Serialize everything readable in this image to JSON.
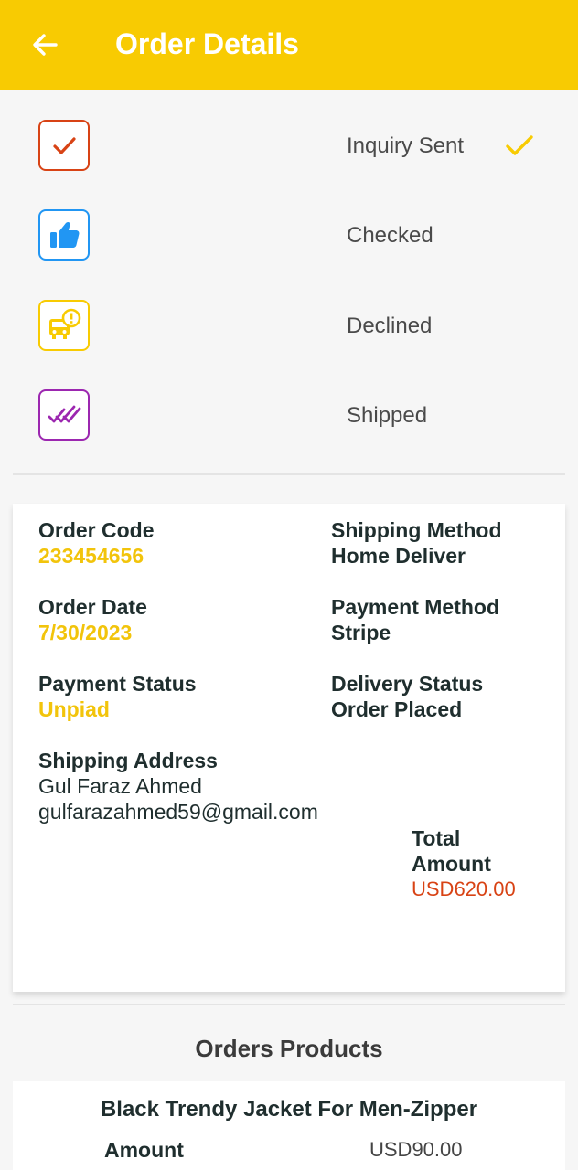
{
  "header": {
    "title": "Order Details",
    "background": "#f8cb02",
    "back_icon": "arrow-left-icon"
  },
  "status_steps": [
    {
      "label": "Inquiry Sent",
      "icon": "check-icon",
      "color": "#d84315",
      "completed": true
    },
    {
      "label": "Checked",
      "icon": "thumbs-up-icon",
      "color": "#2196f3",
      "completed": false
    },
    {
      "label": "Declined",
      "icon": "truck-alert-icon",
      "color": "#f8cb02",
      "completed": false
    },
    {
      "label": "Shipped",
      "icon": "double-check-icon",
      "color": "#9c27b0",
      "completed": false
    }
  ],
  "order": {
    "code_label": "Order Code",
    "code": "233454656",
    "shipping_method_label": "Shipping Method",
    "shipping_method": "Home Deliver",
    "date_label": "Order Date",
    "date": "7/30/2023",
    "payment_method_label": "Payment Method",
    "payment_method": "Stripe",
    "payment_status_label": "Payment Status",
    "payment_status": "Unpiad",
    "delivery_status_label": "Delivery Status",
    "delivery_status": "Order Placed",
    "address_label": "Shipping Address",
    "address_name": "Gul Faraz Ahmed",
    "address_email": "gulfarazahmed59@gmail.com",
    "total_label_line1": "Total",
    "total_label_line2": "Amount",
    "total": "USD620.00"
  },
  "products": {
    "section_title": "Orders Products",
    "items": [
      {
        "name": "Black Trendy Jacket For Men-Zipper",
        "amount_label": "Amount",
        "amount": "USD90.00"
      }
    ]
  },
  "colors": {
    "accent": "#f8cb02",
    "value_yellow": "#f2c40b",
    "total_red": "#d84315"
  }
}
